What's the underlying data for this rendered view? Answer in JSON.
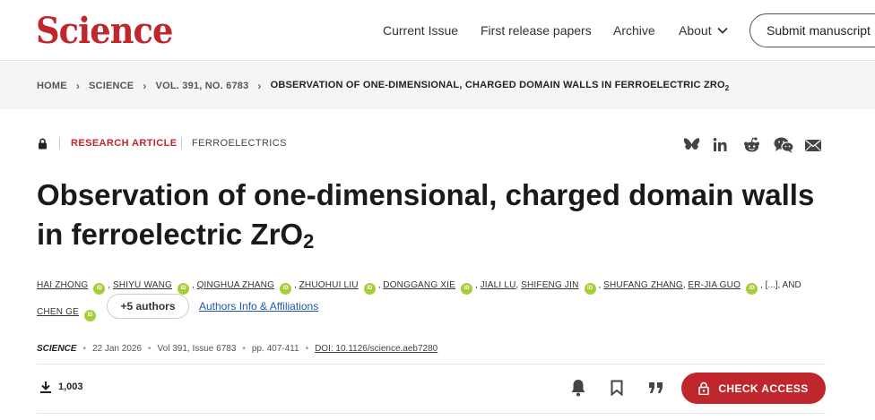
{
  "header": {
    "logo": "Science",
    "nav": [
      "Current Issue",
      "First release papers",
      "Archive",
      "About"
    ],
    "submit_label": "Submit manuscript"
  },
  "breadcrumb": [
    "HOME",
    "SCIENCE",
    "VOL. 391, NO. 6783",
    "OBSERVATION OF ONE-DIMENSIONAL, CHARGED DOMAIN WALLS IN FERROELECTRIC ZRO"
  ],
  "breadcrumb_subscript": "2",
  "article": {
    "type": "RESEARCH ARTICLE",
    "topic": "FERROELECTRICS",
    "title_line1": "Observation of one-dimensional, charged domain walls",
    "title_line2": "in ferroelectric ZrO",
    "title_subscript": "2",
    "authors": [
      "HAI ZHONG",
      "SHIYU WANG",
      "QINGHUA ZHANG",
      "ZHUOHUI LIU",
      "DONGGANG XIE",
      "JIALI LU",
      "SHIFENG JIN",
      "SHUFANG ZHANG",
      "ER-JIA GUO"
    ],
    "ellipsis": "[...]",
    "and_text": ", AND",
    "last_author": "CHEN GE",
    "orcid_label": "iD",
    "more_authors": "+5 authors",
    "affiliations_link": "Authors Info & Affiliations"
  },
  "publication": {
    "journal": "SCIENCE",
    "date": "22 Jan 2026",
    "volume": "Vol 391, Issue 6783",
    "pages": "pp. 407-411",
    "doi": "DOI: 10.1126/science.aeb7280"
  },
  "toolbar": {
    "downloads": "1,003",
    "check_access": "CHECK ACCESS"
  },
  "colors": {
    "brand": "#c0272d",
    "orcid": "#a6ce39",
    "link": "#2059a8"
  },
  "icons": [
    "lock-icon",
    "bluesky-icon",
    "linkedin-icon",
    "reddit-icon",
    "wechat-icon",
    "email-icon",
    "download-icon",
    "bell-icon",
    "bookmark-icon",
    "quote-icon",
    "chevron-down-icon",
    "chevron-right-icon"
  ]
}
